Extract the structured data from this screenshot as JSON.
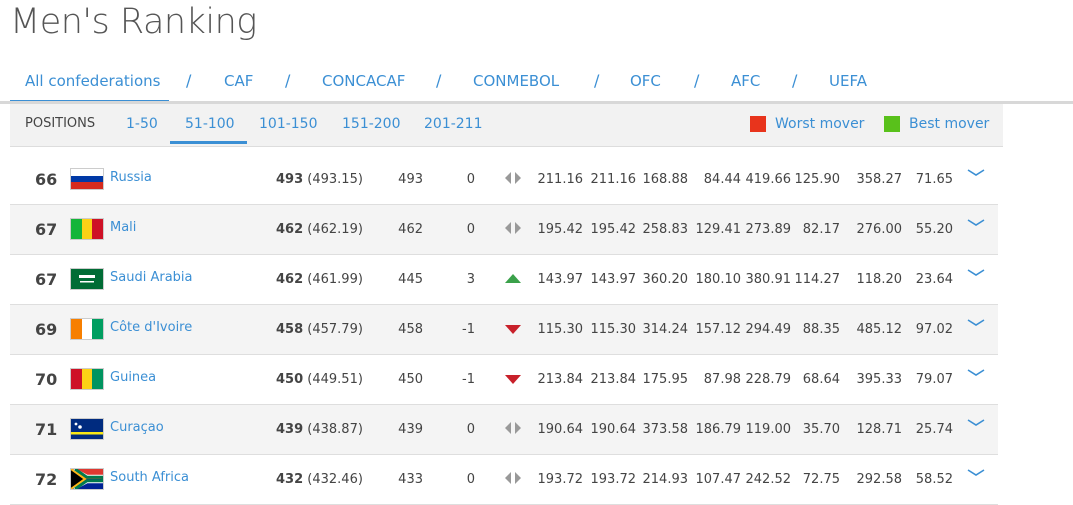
{
  "title": "Men's Ranking",
  "confederations": [
    {
      "label": "All confederations"
    },
    {
      "label": "CAF"
    },
    {
      "label": "CONCACAF"
    },
    {
      "label": "CONMEBOL"
    },
    {
      "label": "OFC"
    },
    {
      "label": "AFC"
    },
    {
      "label": "UEFA"
    }
  ],
  "conf_separator": "/",
  "positions": {
    "label": "POSITIONS",
    "ranges": [
      {
        "label": "1-50"
      },
      {
        "label": "51-100"
      },
      {
        "label": "101-150"
      },
      {
        "label": "151-200"
      },
      {
        "label": "201-211"
      }
    ]
  },
  "legend": {
    "worst": {
      "label": "Worst mover",
      "color": "#e8341c"
    },
    "best": {
      "label": "Best mover",
      "color": "#59c11b"
    }
  },
  "colors": {
    "accent": "#3b8fd4",
    "up": "#3aa14a",
    "down": "#c8202a",
    "neutral": "#999999"
  },
  "rows": [
    {
      "rank": "66",
      "team": "Russia",
      "flag": "russia",
      "points": "493",
      "points_exact": "(493.15)",
      "prev": "493",
      "change": "0",
      "trend": "same",
      "cols": [
        "211.16",
        "211.16",
        "168.88",
        "84.44",
        "419.66",
        "125.90",
        "358.27",
        "71.65"
      ]
    },
    {
      "rank": "67",
      "team": "Mali",
      "flag": "mali",
      "points": "462",
      "points_exact": "(462.19)",
      "prev": "462",
      "change": "0",
      "trend": "same",
      "cols": [
        "195.42",
        "195.42",
        "258.83",
        "129.41",
        "273.89",
        "82.17",
        "276.00",
        "55.20"
      ]
    },
    {
      "rank": "67",
      "team": "Saudi Arabia",
      "flag": "saudi",
      "points": "462",
      "points_exact": "(461.99)",
      "prev": "445",
      "change": "3",
      "trend": "up",
      "cols": [
        "143.97",
        "143.97",
        "360.20",
        "180.10",
        "380.91",
        "114.27",
        "118.20",
        "23.64"
      ]
    },
    {
      "rank": "69",
      "team": "Côte d'Ivoire",
      "flag": "civ",
      "points": "458",
      "points_exact": "(457.79)",
      "prev": "458",
      "change": "-1",
      "trend": "down",
      "cols": [
        "115.30",
        "115.30",
        "314.24",
        "157.12",
        "294.49",
        "88.35",
        "485.12",
        "97.02"
      ]
    },
    {
      "rank": "70",
      "team": "Guinea",
      "flag": "guinea",
      "points": "450",
      "points_exact": "(449.51)",
      "prev": "450",
      "change": "-1",
      "trend": "down",
      "cols": [
        "213.84",
        "213.84",
        "175.95",
        "87.98",
        "228.79",
        "68.64",
        "395.33",
        "79.07"
      ]
    },
    {
      "rank": "71",
      "team": "Curaçao",
      "flag": "curacao",
      "points": "439",
      "points_exact": "(438.87)",
      "prev": "439",
      "change": "0",
      "trend": "same",
      "cols": [
        "190.64",
        "190.64",
        "373.58",
        "186.79",
        "119.00",
        "35.70",
        "128.71",
        "25.74"
      ]
    },
    {
      "rank": "72",
      "team": "South Africa",
      "flag": "rsa",
      "points": "432",
      "points_exact": "(432.46)",
      "prev": "433",
      "change": "0",
      "trend": "same",
      "cols": [
        "193.72",
        "193.72",
        "214.93",
        "107.47",
        "242.52",
        "72.75",
        "292.58",
        "58.52"
      ]
    }
  ]
}
